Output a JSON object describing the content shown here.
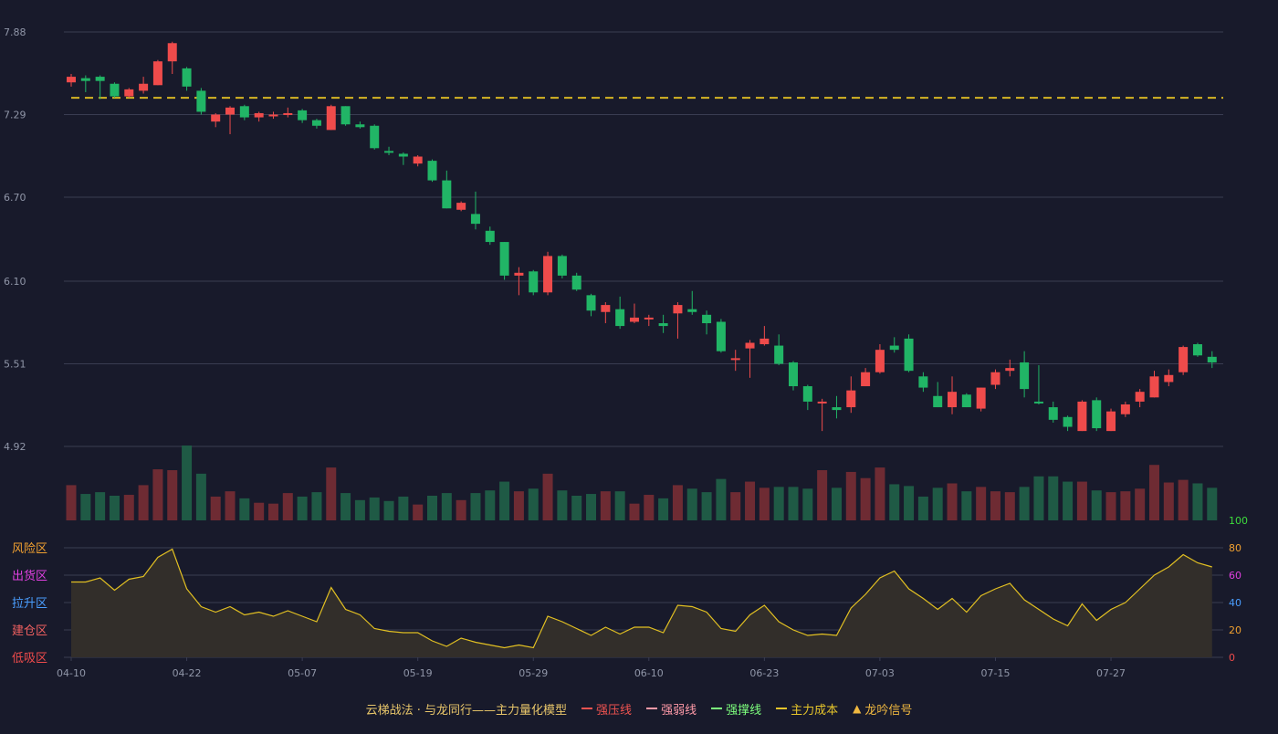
{
  "chart_data": {
    "type": "candlestick",
    "x_labels": [
      "04-10",
      "04-22",
      "05-07",
      "05-19",
      "05-29",
      "06-10",
      "06-23",
      "07-03",
      "07-15",
      "07-27"
    ],
    "price_axis": {
      "ticks": [
        "7.88",
        "7.29",
        "6.70",
        "6.10",
        "5.51",
        "4.92"
      ],
      "ylim": [
        4.92,
        7.88
      ]
    },
    "main_cost_line": 7.41,
    "candles": [
      [
        7.52,
        7.56,
        7.58,
        7.49
      ],
      [
        7.55,
        7.53,
        7.57,
        7.45
      ],
      [
        7.56,
        7.53,
        7.57,
        7.4
      ],
      [
        7.51,
        7.42,
        7.52,
        7.41
      ],
      [
        7.42,
        7.47,
        7.48,
        7.41
      ],
      [
        7.46,
        7.51,
        7.56,
        7.44
      ],
      [
        7.5,
        7.67,
        7.68,
        7.5
      ],
      [
        7.67,
        7.8,
        7.81,
        7.58
      ],
      [
        7.62,
        7.49,
        7.63,
        7.46
      ],
      [
        7.46,
        7.31,
        7.48,
        7.29
      ],
      [
        7.24,
        7.29,
        7.3,
        7.2
      ],
      [
        7.29,
        7.34,
        7.35,
        7.15
      ],
      [
        7.35,
        7.27,
        7.36,
        7.25
      ],
      [
        7.27,
        7.3,
        7.31,
        7.24
      ],
      [
        7.29,
        7.29,
        7.31,
        7.26
      ],
      [
        7.3,
        7.3,
        7.34,
        7.27
      ],
      [
        7.32,
        7.25,
        7.33,
        7.23
      ],
      [
        7.25,
        7.21,
        7.26,
        7.19
      ],
      [
        7.18,
        7.35,
        7.36,
        7.18
      ],
      [
        7.35,
        7.22,
        7.35,
        7.21
      ],
      [
        7.22,
        7.2,
        7.24,
        7.19
      ],
      [
        7.21,
        7.05,
        7.22,
        7.04
      ],
      [
        7.03,
        7.02,
        7.06,
        7.0
      ],
      [
        7.01,
        6.99,
        7.02,
        6.93
      ],
      [
        6.94,
        6.99,
        7.0,
        6.92
      ],
      [
        6.96,
        6.82,
        6.97,
        6.81
      ],
      [
        6.82,
        6.62,
        6.89,
        6.62
      ],
      [
        6.61,
        6.66,
        6.67,
        6.6
      ],
      [
        6.58,
        6.51,
        6.74,
        6.47
      ],
      [
        6.46,
        6.38,
        6.49,
        6.36
      ],
      [
        6.38,
        6.14,
        6.38,
        6.11
      ],
      [
        6.14,
        6.16,
        6.2,
        6.0
      ],
      [
        6.17,
        6.02,
        6.18,
        6.0
      ],
      [
        6.02,
        6.28,
        6.31,
        6.0
      ],
      [
        6.28,
        6.14,
        6.29,
        6.12
      ],
      [
        6.14,
        6.04,
        6.16,
        6.03
      ],
      [
        6.0,
        5.89,
        6.01,
        5.85
      ],
      [
        5.88,
        5.93,
        5.95,
        5.8
      ],
      [
        5.9,
        5.78,
        5.99,
        5.76
      ],
      [
        5.81,
        5.84,
        5.94,
        5.8
      ],
      [
        5.84,
        5.84,
        5.86,
        5.78
      ],
      [
        5.8,
        5.78,
        5.86,
        5.73
      ],
      [
        5.87,
        5.93,
        5.95,
        5.69
      ],
      [
        5.9,
        5.88,
        6.03,
        5.86
      ],
      [
        5.86,
        5.8,
        5.89,
        5.72
      ],
      [
        5.81,
        5.6,
        5.83,
        5.59
      ],
      [
        5.55,
        5.55,
        5.61,
        5.46
      ],
      [
        5.62,
        5.66,
        5.68,
        5.41
      ],
      [
        5.65,
        5.69,
        5.78,
        5.64
      ],
      [
        5.64,
        5.51,
        5.72,
        5.5
      ],
      [
        5.52,
        5.35,
        5.53,
        5.32
      ],
      [
        5.35,
        5.24,
        5.36,
        5.18
      ],
      [
        5.23,
        5.24,
        5.26,
        5.03
      ],
      [
        5.2,
        5.18,
        5.28,
        5.12
      ],
      [
        5.2,
        5.32,
        5.42,
        5.16
      ],
      [
        5.35,
        5.45,
        5.48,
        5.35
      ],
      [
        5.45,
        5.61,
        5.65,
        5.44
      ],
      [
        5.64,
        5.61,
        5.7,
        5.59
      ],
      [
        5.69,
        5.46,
        5.72,
        5.45
      ],
      [
        5.42,
        5.34,
        5.45,
        5.31
      ],
      [
        5.28,
        5.2,
        5.38,
        5.2
      ],
      [
        5.2,
        5.31,
        5.42,
        5.15
      ],
      [
        5.29,
        5.2,
        5.3,
        5.2
      ],
      [
        5.19,
        5.34,
        5.34,
        5.17
      ],
      [
        5.36,
        5.45,
        5.47,
        5.33
      ],
      [
        5.46,
        5.48,
        5.54,
        5.42
      ],
      [
        5.52,
        5.33,
        5.6,
        5.27
      ],
      [
        5.24,
        5.23,
        5.5,
        5.22
      ],
      [
        5.2,
        5.11,
        5.24,
        5.09
      ],
      [
        5.13,
        5.06,
        5.14,
        5.03
      ],
      [
        5.03,
        5.24,
        5.25,
        5.03
      ],
      [
        5.25,
        5.05,
        5.27,
        5.03
      ],
      [
        5.03,
        5.17,
        5.19,
        5.03
      ],
      [
        5.15,
        5.22,
        5.24,
        5.13
      ],
      [
        5.24,
        5.31,
        5.33,
        5.2
      ],
      [
        5.27,
        5.42,
        5.46,
        5.27
      ],
      [
        5.38,
        5.43,
        5.47,
        5.35
      ],
      [
        5.45,
        5.63,
        5.64,
        5.43
      ],
      [
        5.65,
        5.57,
        5.66,
        5.56
      ],
      [
        5.56,
        5.52,
        5.6,
        5.48
      ]
    ],
    "volume": [
      40,
      30,
      32,
      28,
      29,
      40,
      58,
      57,
      85,
      53,
      27,
      33,
      25,
      20,
      19,
      31,
      27,
      32,
      60,
      31,
      23,
      26,
      22,
      27,
      18,
      28,
      31,
      23,
      31,
      34,
      44,
      33,
      36,
      53,
      34,
      28,
      30,
      33,
      33,
      19,
      29,
      25,
      40,
      36,
      32,
      47,
      32,
      44,
      37,
      38,
      38,
      36,
      57,
      37,
      55,
      48,
      60,
      41,
      39,
      27,
      37,
      42,
      33,
      38,
      33,
      32,
      38,
      50,
      50,
      44,
      44,
      34,
      32,
      33,
      36,
      63,
      43,
      46,
      42,
      37
    ],
    "oscillator": {
      "right_ticks": [
        "100",
        "80",
        "60",
        "40",
        "20",
        "0"
      ],
      "zones": [
        "风险区",
        "出货区",
        "拉升区",
        "建仓区",
        "低吸区"
      ],
      "values": [
        55,
        55,
        58,
        49,
        57,
        59,
        73,
        79,
        50,
        37,
        33,
        37,
        31,
        33,
        30,
        34,
        30,
        26,
        51,
        35,
        31,
        21,
        19,
        18,
        18,
        12,
        8,
        14,
        11,
        9,
        7,
        9,
        7,
        30,
        26,
        21,
        16,
        22,
        17,
        22,
        22,
        18,
        38,
        37,
        33,
        21,
        19,
        31,
        38,
        26,
        20,
        16,
        17,
        16,
        36,
        46,
        58,
        63,
        50,
        43,
        35,
        43,
        33,
        45,
        50,
        54,
        42,
        35,
        28,
        23,
        39,
        27,
        35,
        40,
        50,
        60,
        66,
        75,
        69,
        66
      ]
    },
    "legend": [
      {
        "label": "云梯战法 · 与龙同行——主力量化模型",
        "color": "#e8c66a",
        "style": "none"
      },
      {
        "label": "强压线",
        "color": "#ef5350",
        "style": "solid"
      },
      {
        "label": "强弱线",
        "color": "#ff9aa8",
        "style": "dashed"
      },
      {
        "label": "强撑线",
        "color": "#7dff7d",
        "style": "solid"
      },
      {
        "label": "主力成本",
        "color": "#e6c52b",
        "style": "dashed"
      },
      {
        "label": "龙吟信号",
        "color": "#f0b840",
        "style": "triangle"
      }
    ],
    "colors": {
      "up": "#ef4b4b",
      "down": "#21b566",
      "vol_up": "#6e2b33",
      "vol_down": "#1f5a45",
      "cost": "#d6b624",
      "osc_line": "#e2c022",
      "bg": "#181a2b",
      "grid": "#3a3d52",
      "axis_text": "#9096a8"
    }
  }
}
